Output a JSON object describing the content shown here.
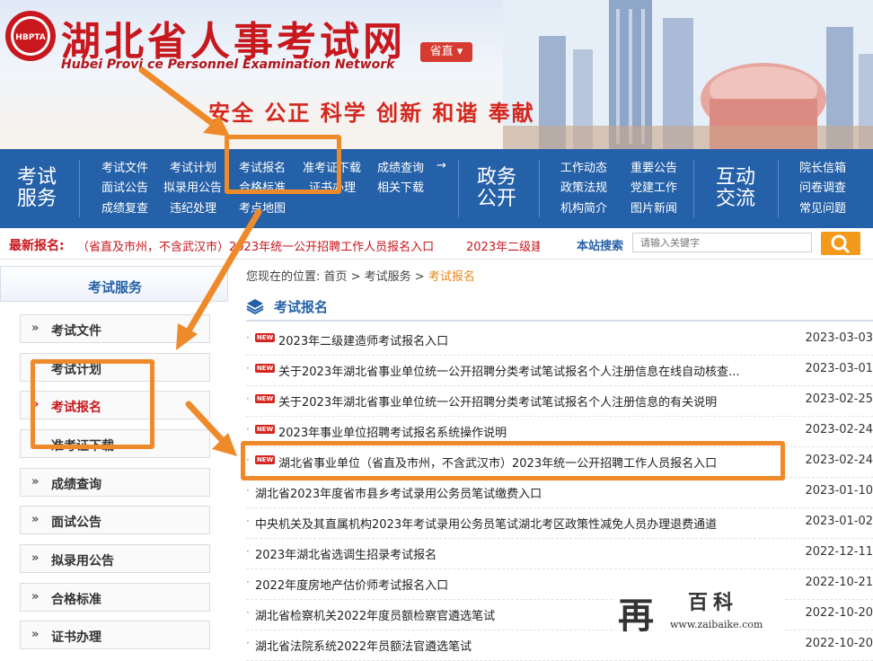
{
  "header": {
    "logo_text": "HBPTA",
    "title": "湖北省人事考试网",
    "subtitle": "Hubei Provi   ce Personnel Examination Network",
    "region_button": "省直 ▾",
    "slogan": "安全 公正 科学 创新 和谐 奉献"
  },
  "nav": {
    "section_exam": "考试服务",
    "exam_links": [
      "考试文件",
      "考试计划",
      "考试报名",
      "准考证下载",
      "成绩查询",
      "面试公告",
      "拟录用公告",
      "合格标准",
      "证书办理",
      "相关下载",
      "成绩复查",
      "违纪处理",
      "考点地图"
    ],
    "more_arrow": "→",
    "section_gov": "政务公开",
    "gov_links": [
      "工作动态",
      "重要公告",
      "政策法规",
      "党建工作",
      "机构简介",
      "图片新闻"
    ],
    "section_interact": "互动交流",
    "interact_links": [
      "院长信箱",
      "问卷调查",
      "常见问题"
    ]
  },
  "newsbar": {
    "label": "最新报名:",
    "item1": "（省直及市州，不含武汉市）2023年统一公开招聘工作人员报名入口",
    "item2": "2023年二级建",
    "search_label": "本站搜索",
    "search_placeholder": "请输入关键字",
    "search_icon": "search-icon"
  },
  "sidebar": {
    "title": "考试服务",
    "items": [
      {
        "label": "考试文件",
        "arrow": "»"
      },
      {
        "label": "考试计划",
        "arrow": ""
      },
      {
        "label": "考试报名",
        "arrow": "»",
        "active": true
      },
      {
        "label": "准考证下载",
        "arrow": ""
      },
      {
        "label": "成绩查询",
        "arrow": "»"
      },
      {
        "label": "面试公告",
        "arrow": "»"
      },
      {
        "label": "拟录用公告",
        "arrow": "»"
      },
      {
        "label": "合格标准",
        "arrow": "»"
      },
      {
        "label": "证书办理",
        "arrow": "»"
      }
    ]
  },
  "main": {
    "breadcrumb_prefix": "您现在的位置:  首页 > 考试服务 > ",
    "breadcrumb_current": "考试报名",
    "section_title": "考试报名",
    "new_badge": "NEW",
    "rows": [
      {
        "title": "2023年二级建造师考试报名入口",
        "date": "2023-03-03",
        "new": true
      },
      {
        "title": "关于2023年湖北省事业单位统一公开招聘分类考试笔试报名个人注册信息在线自动核查...",
        "date": "2023-03-01",
        "new": true
      },
      {
        "title": "关于2023年湖北省事业单位统一公开招聘分类考试笔试报名个人注册信息的有关说明",
        "date": "2023-02-25",
        "new": true
      },
      {
        "title": "2023年事业单位招聘考试报名系统操作说明",
        "date": "2023-02-24",
        "new": true
      },
      {
        "title": "湖北省事业单位（省直及市州，不含武汉市）2023年统一公开招聘工作人员报名入口",
        "date": "2023-02-24",
        "new": true
      },
      {
        "title": "湖北省2023年度省市县乡考试录用公务员笔试缴费入口",
        "date": "2023-01-10",
        "new": false
      },
      {
        "title": "中央机关及其直属机构2023年考试录用公务员笔试湖北考区政策性减免人员办理退费通道",
        "date": "2023-01-02",
        "new": false
      },
      {
        "title": "2023年湖北省选调生招录考试报名",
        "date": "2022-12-11",
        "new": false
      },
      {
        "title": "2022年度房地产估价师考试报名入口",
        "date": "2022-10-21",
        "new": false
      },
      {
        "title": "湖北省检察机关2022年度员额检察官遴选笔试",
        "date": "2022-10-20",
        "new": false
      },
      {
        "title": "湖北省法院系统2022年员额法官遴选笔试",
        "date": "2022-10-20",
        "new": false
      }
    ]
  },
  "watermark": {
    "icon": "再",
    "title": "百科",
    "url": "www.zaibaike.com"
  },
  "colors": {
    "brand_red": "#c8171d",
    "nav_blue": "#2561a8",
    "annotation_orange": "#ef8a2a",
    "search_orange": "#f39a1c"
  }
}
